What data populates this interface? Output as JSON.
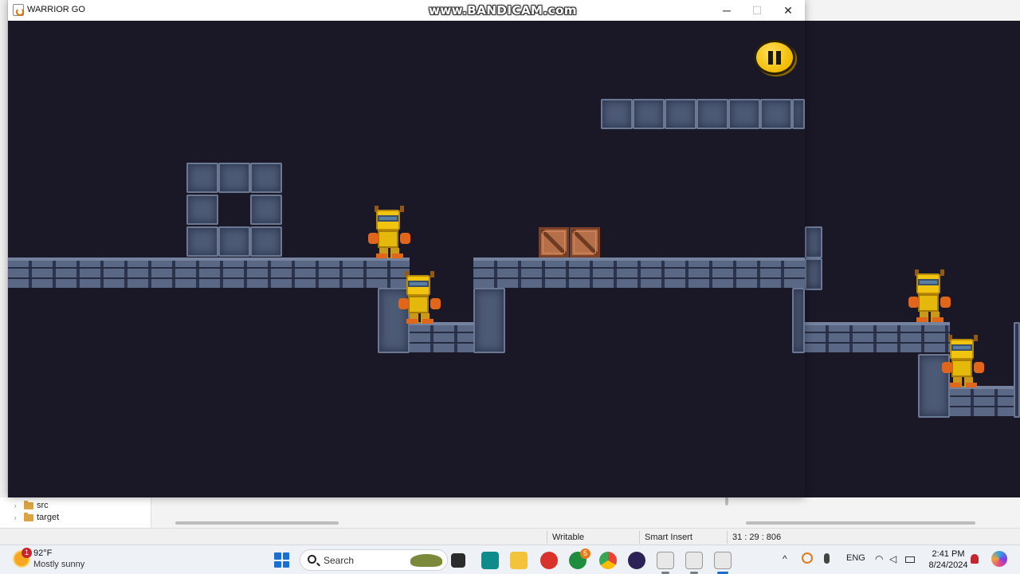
{
  "overlay": {
    "watermark": "www.BANDICAM.com"
  },
  "game_window": {
    "title": "WARRIOR GO",
    "controls": {
      "minimize": "─",
      "maximize": "☐",
      "close": "✕"
    }
  },
  "ide": {
    "tree": [
      {
        "label": "src",
        "icon": "folder-icon"
      },
      {
        "label": "target",
        "icon": "folder-icon"
      }
    ],
    "status": {
      "mode": "Writable",
      "insert": "Smart Insert",
      "position": "31 : 29 : 806"
    }
  },
  "taskbar": {
    "weather": {
      "temp": "92°F",
      "desc": "Mostly sunny",
      "badge": "1"
    },
    "search_placeholder": "Search",
    "language": "ENG",
    "time": "2:41 PM",
    "date": "8/24/2024",
    "xbox_badge": "5",
    "colors": {
      "start": "#1b6fd1",
      "accent": "#f2bb00"
    }
  }
}
